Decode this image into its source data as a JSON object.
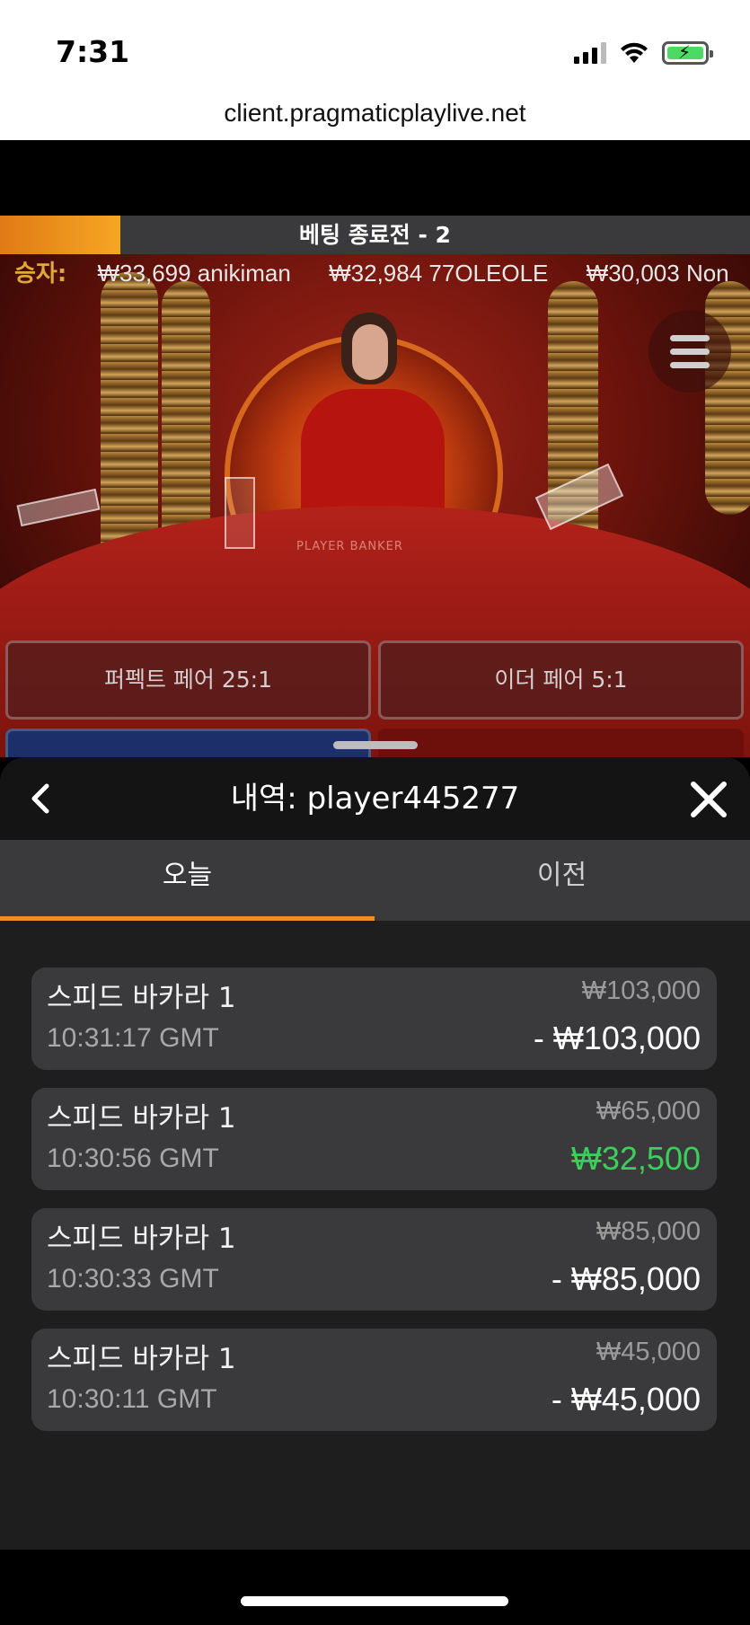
{
  "status_bar": {
    "time": "7:31",
    "icons": [
      "cellular-signal-icon",
      "wifi-icon",
      "battery-charging-icon"
    ],
    "battery_color": "#4cd964"
  },
  "browser": {
    "url": "client.pragmaticplaylive.net"
  },
  "game": {
    "countdown_text": "베팅 종료전 - 2",
    "countdown_progress": 0.16,
    "countdown_color": "#f5a623",
    "winners_label": "승자:",
    "winners": [
      "₩33,699 anikiman",
      "₩32,984 77OLEOLE",
      "₩30,003 Non"
    ],
    "table_label": "PLAYER BANKER",
    "menu_icon": "hamburger-menu-icon",
    "side_bets": [
      {
        "label": "퍼펙트 페어 25:1"
      },
      {
        "label": "이더 페어 5:1"
      }
    ]
  },
  "history": {
    "title": "내역: player445277",
    "back_icon": "chevron-left-icon",
    "close_icon": "close-icon",
    "tabs": [
      {
        "label": "오늘",
        "active": true
      },
      {
        "label": "이전",
        "active": false
      }
    ],
    "accent_color": "#f28c1e",
    "win_color": "#3ccf5a",
    "items": [
      {
        "game": "스피드 바카라 1",
        "time": "10:31:17 GMT",
        "bet": "₩103,000",
        "result": "- ₩103,000",
        "win": false
      },
      {
        "game": "스피드 바카라 1",
        "time": "10:30:56 GMT",
        "bet": "₩65,000",
        "result": "₩32,500",
        "win": true
      },
      {
        "game": "스피드 바카라 1",
        "time": "10:30:33 GMT",
        "bet": "₩85,000",
        "result": "- ₩85,000",
        "win": false
      },
      {
        "game": "스피드 바카라 1",
        "time": "10:30:11 GMT",
        "bet": "₩45,000",
        "result": "- ₩45,000",
        "win": false
      }
    ]
  }
}
